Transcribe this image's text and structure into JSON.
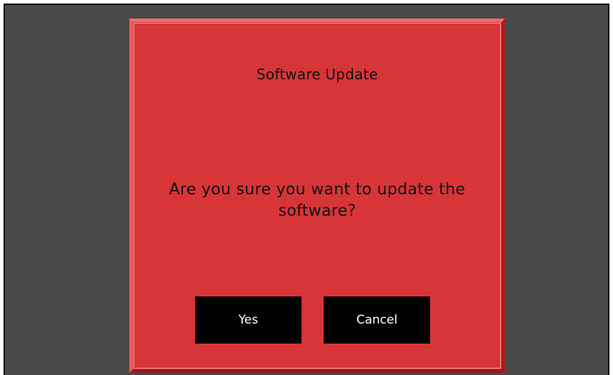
{
  "dialog": {
    "title": "Software Update",
    "message": "Are you sure you want to update the software?",
    "buttons": {
      "yes_label": "Yes",
      "cancel_label": "Cancel"
    }
  },
  "colors": {
    "screen_background": "#494949",
    "dialog_background": "#d73537",
    "button_background": "#000000",
    "button_text": "#ffffff",
    "text": "#111111"
  }
}
